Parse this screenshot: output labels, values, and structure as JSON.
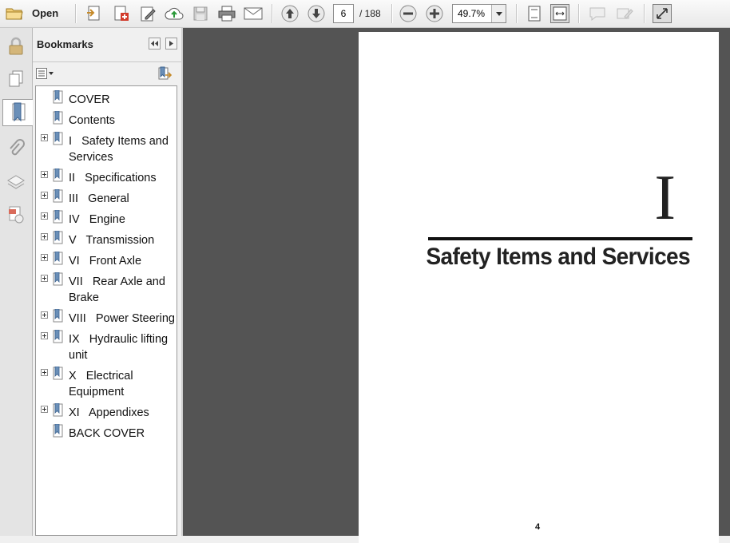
{
  "toolbar": {
    "open_label": "Open",
    "current_page": "6",
    "page_total": "/ 188",
    "zoom": "49.7%",
    "icons": [
      "folder-icon",
      "create-pdf-icon",
      "combine-icon",
      "sign-icon",
      "upload-icon",
      "save-icon",
      "print-icon",
      "email-icon",
      "page-up-icon",
      "page-down-icon",
      "zoom-out-icon",
      "zoom-in-icon",
      "fit-page-icon",
      "fit-width-icon",
      "comment-icon",
      "highlight-icon",
      "fullscreen-icon"
    ]
  },
  "rail": {
    "icons": [
      "lock-icon",
      "pages-icon",
      "bookmark-icon",
      "attachment-icon",
      "layers-icon",
      "signature-icon"
    ]
  },
  "bookmarks": {
    "title": "Bookmarks",
    "items": [
      {
        "label": "COVER",
        "expandable": false
      },
      {
        "label": "Contents",
        "expandable": false
      },
      {
        "label": "I   Safety Items and Services",
        "expandable": true
      },
      {
        "label": "II   Specifications",
        "expandable": true
      },
      {
        "label": "III   General",
        "expandable": true
      },
      {
        "label": "IV   Engine",
        "expandable": true
      },
      {
        "label": "V   Transmission",
        "expandable": true
      },
      {
        "label": "VI   Front Axle",
        "expandable": true
      },
      {
        "label": "VII   Rear Axle and Brake",
        "expandable": true
      },
      {
        "label": "VIII   Power Steering",
        "expandable": true
      },
      {
        "label": "IX   Hydraulic lifting unit",
        "expandable": true
      },
      {
        "label": "X   Electrical Equipment",
        "expandable": true
      },
      {
        "label": "XI   Appendixes",
        "expandable": true
      },
      {
        "label": "BACK COVER",
        "expandable": false
      }
    ]
  },
  "document": {
    "chapter_numeral": "I",
    "chapter_title": "Safety Items and Services",
    "page_number": "4"
  },
  "colors": {
    "doc_background": "#545454",
    "bookmark_blue": "#6a8fb8"
  }
}
